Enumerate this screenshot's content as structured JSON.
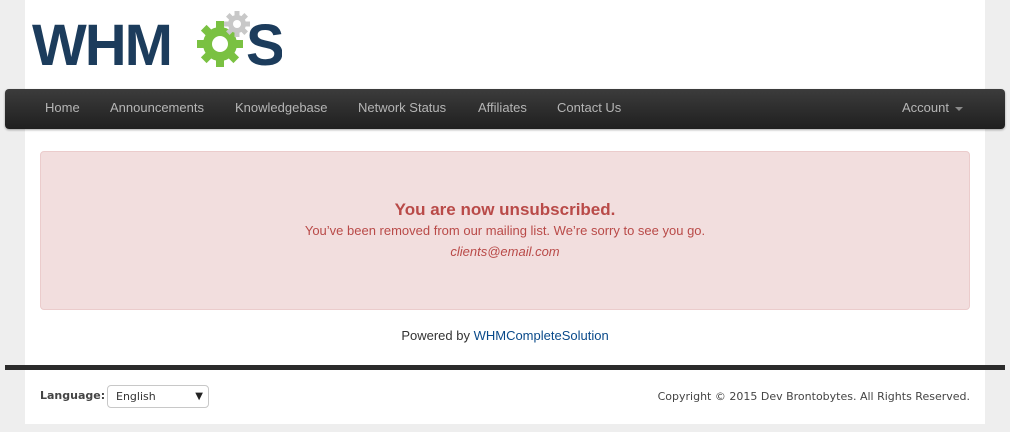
{
  "brand": {
    "logo_text": "WHMCS",
    "colors": {
      "navy": "#1c3c5c",
      "green": "#7ac142",
      "gear_gray": "#c8c8c8"
    }
  },
  "nav": {
    "items": [
      {
        "label": "Home"
      },
      {
        "label": "Announcements"
      },
      {
        "label": "Knowledgebase"
      },
      {
        "label": "Network Status"
      },
      {
        "label": "Affiliates"
      },
      {
        "label": "Contact Us"
      }
    ],
    "account_label": "Account"
  },
  "alert": {
    "title": "You are now unsubscribed.",
    "message": "You’ve been removed from our mailing list. We’re sorry to see you go.",
    "email": "clients@email.com"
  },
  "footer": {
    "powered_prefix": "Powered by ",
    "powered_link": "WHMCompleteSolution",
    "language_label": "Language:",
    "language_value": "English",
    "copyright": "Copyright © 2015 Dev Brontobytes. All Rights Reserved."
  }
}
